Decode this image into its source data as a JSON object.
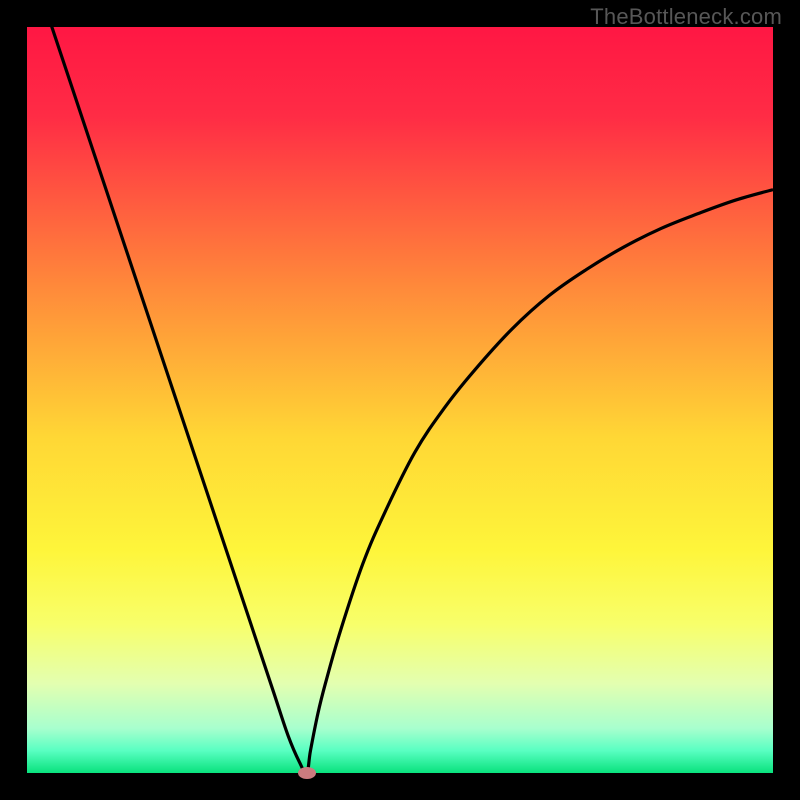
{
  "watermark": "TheBottleneck.com",
  "chart_data": {
    "type": "line",
    "title": "",
    "xlabel": "",
    "ylabel": "",
    "xlim": [
      0,
      100
    ],
    "ylim": [
      0,
      100
    ],
    "background_gradient": {
      "stops": [
        {
          "offset": 0.0,
          "color": "#ff1744"
        },
        {
          "offset": 0.12,
          "color": "#ff2c45"
        },
        {
          "offset": 0.35,
          "color": "#ff8a3a"
        },
        {
          "offset": 0.55,
          "color": "#ffd735"
        },
        {
          "offset": 0.7,
          "color": "#fef53a"
        },
        {
          "offset": 0.8,
          "color": "#f8ff6a"
        },
        {
          "offset": 0.88,
          "color": "#e3ffb0"
        },
        {
          "offset": 0.94,
          "color": "#a8ffce"
        },
        {
          "offset": 0.97,
          "color": "#59ffc2"
        },
        {
          "offset": 1.0,
          "color": "#09e27d"
        }
      ]
    },
    "left_branch": {
      "x": [
        0,
        3,
        6,
        9,
        12,
        15,
        18,
        21,
        24,
        27,
        30,
        33,
        35,
        36.5,
        37.5
      ],
      "y": [
        110,
        101,
        92,
        83,
        74,
        65,
        56,
        47,
        38,
        29,
        20,
        11,
        5,
        1.5,
        0
      ]
    },
    "right_branch": {
      "x": [
        37.5,
        38,
        39,
        40,
        42,
        45,
        48,
        52,
        56,
        60,
        65,
        70,
        75,
        80,
        85,
        90,
        95,
        100
      ],
      "y": [
        0,
        3,
        8,
        12,
        19,
        28,
        35,
        43,
        49,
        54,
        59.5,
        64,
        67.5,
        70.5,
        73,
        75,
        76.8,
        78.2
      ]
    },
    "marker": {
      "x": 37.5,
      "y": 0,
      "color": "#cb7b7f"
    }
  }
}
